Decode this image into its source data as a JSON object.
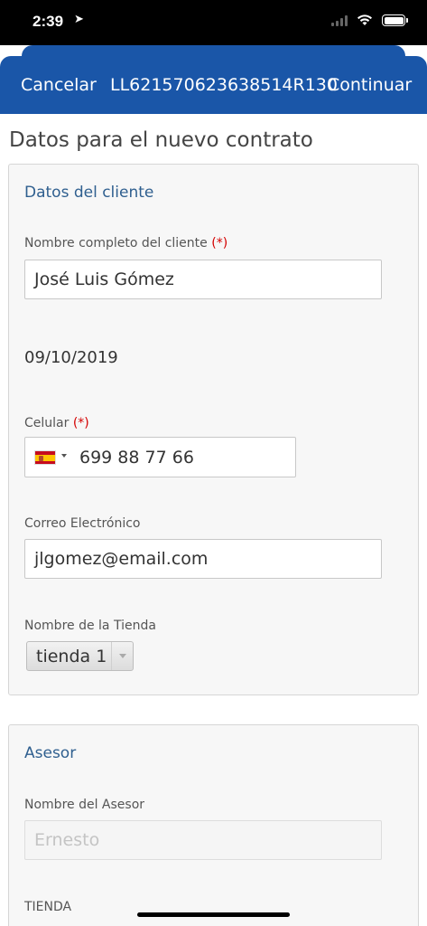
{
  "status_bar": {
    "time": "2:39",
    "location_icon": "location-arrow-icon"
  },
  "nav": {
    "cancel_label": "Cancelar",
    "title": "LL621570623638514R130",
    "continue_label": "Continuar"
  },
  "page": {
    "title": "Datos para el nuevo contrato"
  },
  "client_section": {
    "title": "Datos del cliente",
    "name_label": "Nombre completo del cliente",
    "required_marker": "(*)",
    "name_value": "José Luis Gómez",
    "date_value": "09/10/2019",
    "phone_label": "Celular",
    "phone_required_marker": "(*)",
    "phone_country_flag": "spain-flag-icon",
    "phone_value": "699 88 77 66",
    "email_label": "Correo Electrónico",
    "email_value": "jlgomez@email.com",
    "store_label": "Nombre de la Tienda",
    "store_selected": "tienda 1"
  },
  "asesor_section": {
    "title": "Asesor",
    "asesor_name_label": "Nombre del Asesor",
    "asesor_name_placeholder": "Ernesto",
    "store_label": "TIENDA"
  },
  "colors": {
    "nav_background": "#1a56a8",
    "section_title": "#2f5f8f",
    "required": "#d40000"
  }
}
